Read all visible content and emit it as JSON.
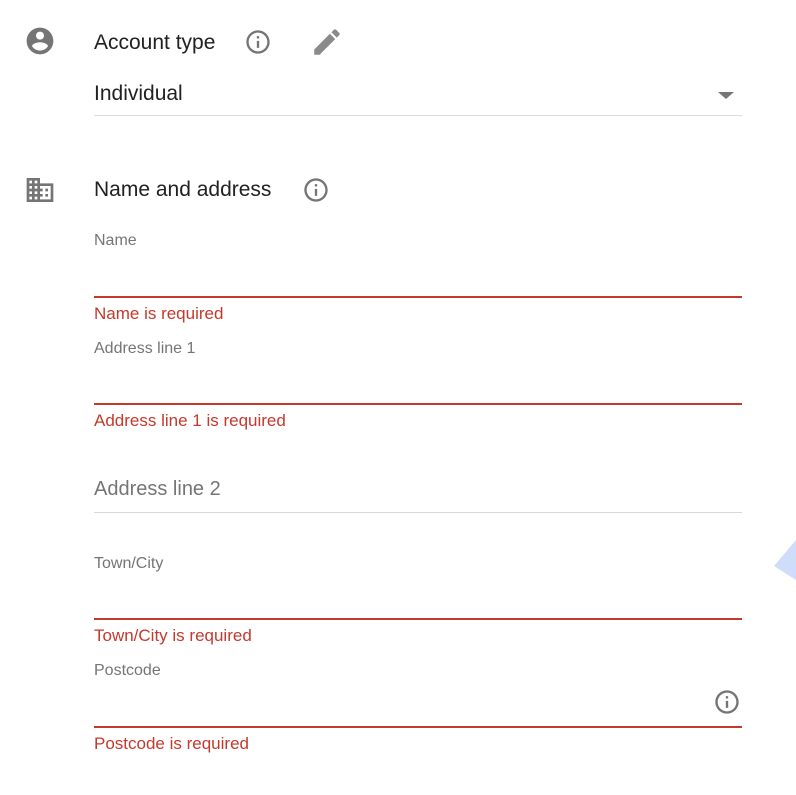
{
  "account_type": {
    "title": "Account type",
    "selected_value": "Individual",
    "icons": {
      "section": "account-circle-icon",
      "info": "info-icon",
      "edit": "edit-pencil-icon",
      "dropdown": "dropdown-arrow-icon"
    }
  },
  "name_and_address": {
    "title": "Name and address",
    "icons": {
      "section": "business-building-icon",
      "info": "info-icon"
    },
    "fields": {
      "name": {
        "label": "Name",
        "value": "",
        "error": "Name is required"
      },
      "address_line_1": {
        "label": "Address line 1",
        "value": "",
        "error": "Address line 1 is required"
      },
      "address_line_2": {
        "placeholder": "Address line 2",
        "value": ""
      },
      "town_city": {
        "label": "Town/City",
        "value": "",
        "error": "Town/City is required"
      },
      "postcode": {
        "label": "Postcode",
        "value": "",
        "error": "Postcode is required",
        "icon": "info-icon"
      }
    }
  },
  "colors": {
    "error": "#c5392c",
    "icon_gray": "#757575",
    "text": "#212121",
    "label": "#757575",
    "accent_shape": "#cfdcfa"
  }
}
